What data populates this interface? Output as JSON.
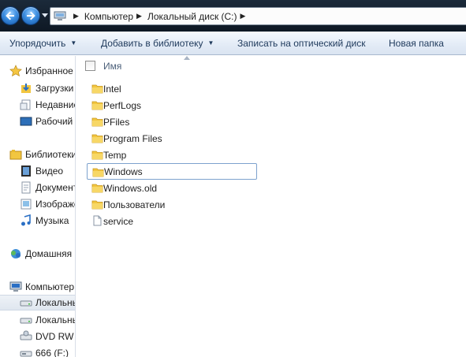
{
  "address_bar": {
    "crumbs": [
      "Компьютер",
      "Локальный диск (C:)"
    ]
  },
  "command_bar": {
    "items": [
      {
        "label": "Упорядочить",
        "dropdown": true
      },
      {
        "label": "Добавить в библиотеку",
        "dropdown": true
      },
      {
        "label": "Записать на оптический диск",
        "dropdown": false
      },
      {
        "label": "Новая папка",
        "dropdown": false
      }
    ]
  },
  "nav_pane": {
    "favorites": {
      "label": "Избранное",
      "items": [
        "Загрузки",
        "Недавние",
        "Рабочий"
      ]
    },
    "libraries": {
      "label": "Библиотеки",
      "items": [
        "Видео",
        "Документы",
        "Изображения",
        "Музыка"
      ]
    },
    "homegroup": {
      "label": "Домашняя группа"
    },
    "computer": {
      "label": "Компьютер",
      "items": [
        "Локальный диск",
        "Локальный диск",
        "DVD RW дисковод",
        "666 (F:)"
      ]
    }
  },
  "content": {
    "column_header": "Имя",
    "files": [
      {
        "name": "Intel",
        "type": "folder"
      },
      {
        "name": "PerfLogs",
        "type": "folder"
      },
      {
        "name": "PFiles",
        "type": "folder"
      },
      {
        "name": "Program Files",
        "type": "folder"
      },
      {
        "name": "Temp",
        "type": "folder"
      },
      {
        "name": "Windows",
        "type": "folder"
      },
      {
        "name": "Windows.old",
        "type": "folder"
      },
      {
        "name": "Пользователи",
        "type": "folder"
      },
      {
        "name": "service",
        "type": "file"
      }
    ]
  },
  "colors": {
    "folder": "#f2c640",
    "address_strip": "#14202d",
    "command_text": "#1e395b"
  }
}
